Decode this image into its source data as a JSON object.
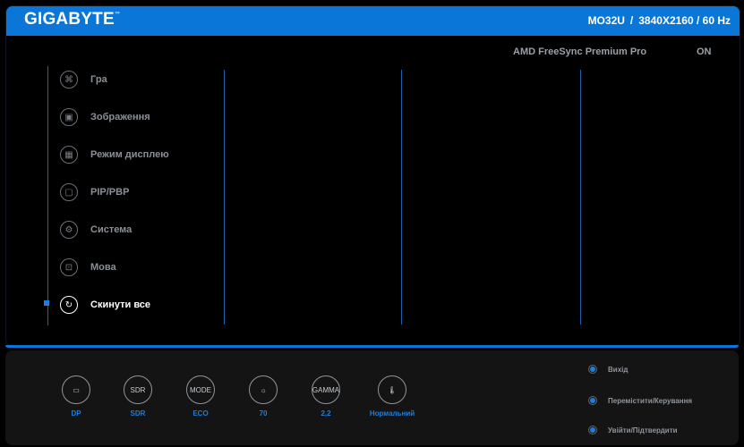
{
  "header": {
    "brand": "GIGABYTE",
    "trademark": "™",
    "model": "MO32U",
    "resolution": "3840X2160 / 60 Hz",
    "separator": "/"
  },
  "status_line": {
    "label": "AMD FreeSync Premium Pro",
    "value": "ON"
  },
  "menu": {
    "items": [
      {
        "label": "Гра",
        "icon": "gamepad-icon"
      },
      {
        "label": "Зображення",
        "icon": "picture-icon"
      },
      {
        "label": "Режим дисплею",
        "icon": "display-mode-icon"
      },
      {
        "label": "PIP/PBP",
        "icon": "pip-icon"
      },
      {
        "label": "Система",
        "icon": "gear-icon"
      },
      {
        "label": "Мова",
        "icon": "language-icon"
      },
      {
        "label": "Скинути все",
        "icon": "reset-icon",
        "active": true
      }
    ]
  },
  "bottom_status": {
    "items": [
      {
        "icon_text": "▭",
        "label": "DP",
        "icon": "displayport-icon"
      },
      {
        "icon_text": "SDR",
        "label": "SDR",
        "icon": "sdr-icon"
      },
      {
        "icon_text": "MODE",
        "label": "ECO",
        "icon": "mode-icon"
      },
      {
        "icon_text": "☼",
        "label": "70",
        "icon": "brightness-icon"
      },
      {
        "icon_text": "GAMMA",
        "label": "2,2",
        "icon": "gamma-icon"
      },
      {
        "icon_text": "🌡",
        "label": "Нормальний",
        "icon": "thermometer-icon"
      }
    ]
  },
  "nav_hints": {
    "items": [
      {
        "label": "Вихід",
        "icon": "joystick-left-icon"
      },
      {
        "label": "Перемістити/Керування",
        "icon": "joystick-up-icon"
      },
      {
        "label": "Увійти/Підтвердити",
        "icon": "joystick-right-icon"
      }
    ]
  },
  "colors": {
    "accent": "#0a77d8",
    "active_text": "#ffffff",
    "inactive_text": "#8a8f96",
    "status_text": "#1a7fe0"
  }
}
